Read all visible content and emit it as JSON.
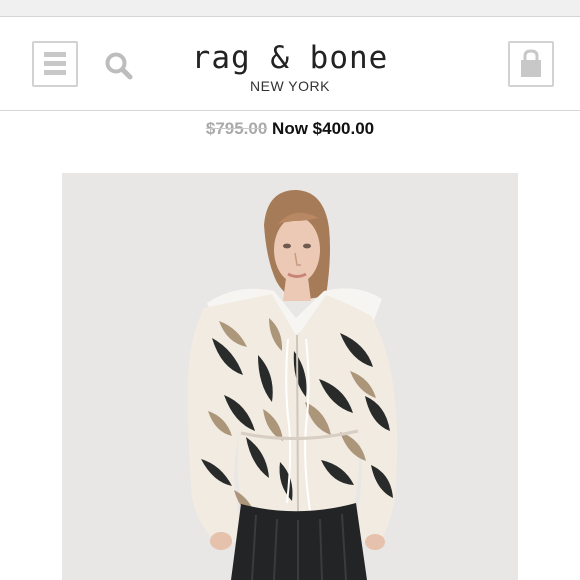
{
  "brand": {
    "name": "rag & bone",
    "location": "NEW YORK"
  },
  "header": {
    "menu_icon": "menu-icon",
    "search_icon": "search-icon",
    "bag_icon": "shopping-bag-icon"
  },
  "product": {
    "original_price": "$795.00",
    "sale_prefix": "Now",
    "sale_price": "$400.00"
  },
  "colors": {
    "background": "#ffffff",
    "icon_gray": "#c8c8c8",
    "old_price_gray": "#a9a9a9",
    "text_dark": "#111111"
  }
}
